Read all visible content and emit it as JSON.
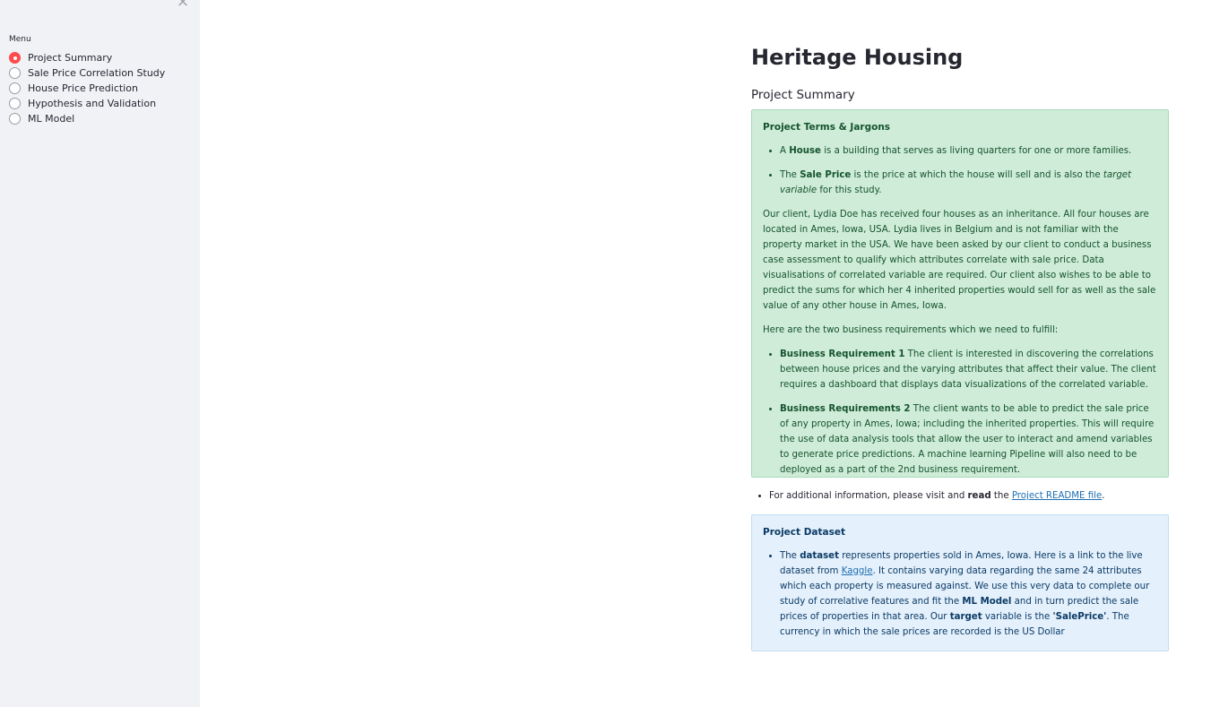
{
  "sidebar": {
    "close_label": "×",
    "menu_label": "Menu",
    "items": [
      {
        "label": "Project Summary",
        "selected": true
      },
      {
        "label": "Sale Price Correlation Study",
        "selected": false
      },
      {
        "label": "House Price Prediction",
        "selected": false
      },
      {
        "label": "Hypothesis and Validation",
        "selected": false
      },
      {
        "label": "ML Model",
        "selected": false
      }
    ]
  },
  "main": {
    "title": "Heritage Housing",
    "subheader": "Project Summary",
    "terms_box": {
      "heading": "Project Terms & Jargons",
      "house": {
        "pre": "A ",
        "bold": "House",
        "post": " is a building that serves as living quarters for one or more families."
      },
      "sale_price": {
        "pre": "The ",
        "bold": "Sale Price",
        "mid": " is the price at which the house will sell and is also the ",
        "italic": "target variable",
        "post": " for this study."
      },
      "client_paragraph": "Our client, Lydia Doe has received four houses as an inheritance. All four houses are located in Ames, Iowa, USA. Lydia lives in Belgium and is not familiar with the property market in the USA. We have been asked by our client to conduct a business case assessment to qualify which attributes correlate with sale price. Data visualisations of correlated variable are required. Our client also wishes to be able to predict the sums for which her 4 inherited properties would sell for as well as the sale value of any other house in Ames, Iowa.",
      "requirements_intro": "Here are the two business requirements which we need to fulfill:",
      "br1": {
        "bold": "Business Requirement 1",
        "text": " The client is interested in discovering the correlations between house prices and the varying attributes that affect their value. The client requires a dashboard that displays data visualizations of the correlated variable."
      },
      "br2": {
        "bold": "Business Requirements 2",
        "text": " The client wants to be able to predict the sale price of any property in Ames, Iowa; including the inherited properties. This will require the use of data analysis tools that allow the user to interact and amend variables to generate price predictions. A machine learning Pipeline will also need to be deployed as a part of the 2nd business requirement."
      }
    },
    "readme": {
      "pre": "For additional information, please visit and ",
      "bold": "read",
      "mid": " the ",
      "link": "Project README file",
      "post": "."
    },
    "dataset_box": {
      "heading": "Project Dataset",
      "t1": "The ",
      "b1": "dataset",
      "t2": " represents properties sold in Ames, Iowa. Here is a link to the live dataset from ",
      "link": "Kaggle",
      "t3": ". It contains varying data regarding the same 24 attributes which each property is measured against. We use this very data to complete our study of correlative features and fit the ",
      "b2": "ML Model",
      "t4": " and in turn predict the sale prices of properties in that area. Our ",
      "b3": "target",
      "t5": " variable is the ",
      "b4": "'SalePrice'",
      "t6": ". The currency in which the sale prices are recorded is the US Dollar"
    }
  },
  "colors": {
    "sidebar_bg": "#f0f2f6",
    "radio_selected": "#ff4b4b",
    "success_bg": "#cfecd8",
    "success_text": "#14532d",
    "info_bg": "#e4f0fb",
    "info_text": "#0a3a66",
    "link": "#1f6fb2"
  }
}
